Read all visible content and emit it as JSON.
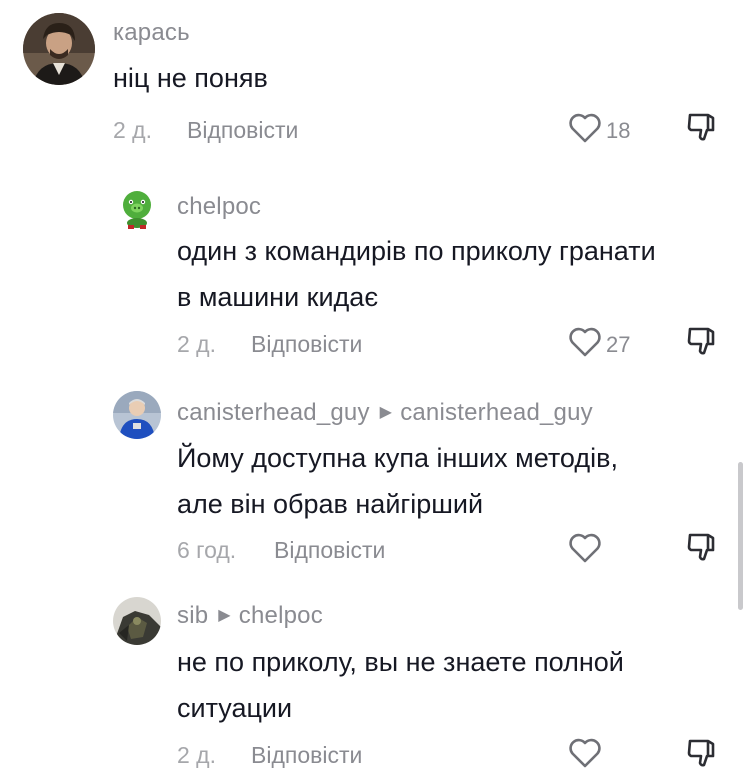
{
  "comments": [
    {
      "username": "карась",
      "reply_to": "",
      "text_lines": [
        "ніц не поняв"
      ],
      "time": "2 д.",
      "reply_label": "Відповісти",
      "likes": "18",
      "avatar_icon": "man-portrait-avatar"
    },
    {
      "username": "chelpoc",
      "reply_to": "",
      "text_lines": [
        "один з командирів по приколу гранати",
        "в машини кидає"
      ],
      "time": "2 д.",
      "reply_label": "Відповісти",
      "likes": "27",
      "avatar_icon": "green-pig-avatar"
    },
    {
      "username": "canisterhead_guy",
      "reply_to": "canisterhead_guy",
      "text_lines": [
        "Йому доступна купа інших методів,",
        "але він обрав найгірший"
      ],
      "time": "6 год.",
      "reply_label": "Відповісти",
      "likes": "",
      "avatar_icon": "blue-jacket-avatar"
    },
    {
      "username": "sib",
      "reply_to": "chelpoc",
      "text_lines": [
        "не по приколу, вы не знаете полной",
        "ситуации"
      ],
      "time": "2 д.",
      "reply_label": "Відповісти",
      "likes": "",
      "avatar_icon": "dark-figure-avatar"
    }
  ],
  "icons": {
    "like": "heart-outline-icon",
    "dislike": "thumbs-down-icon",
    "reply_arrow": "caret-right-icon"
  },
  "colors": {
    "text": "#161823",
    "secondary": "#8a8b91",
    "muted": "#a6a7ab",
    "background": "#ffffff"
  }
}
